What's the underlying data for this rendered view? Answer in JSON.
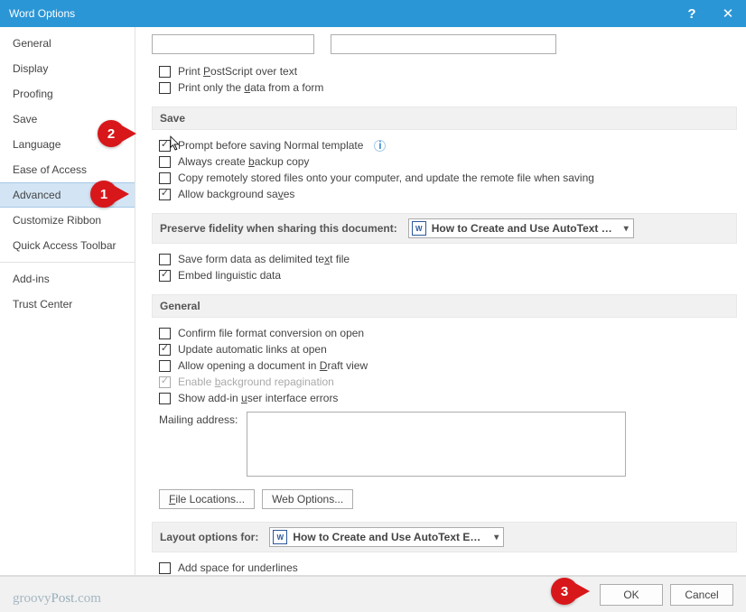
{
  "window": {
    "title": "Word Options",
    "help_symbol": "?",
    "close_symbol": "✕"
  },
  "sidebar": {
    "items": [
      {
        "label": "General"
      },
      {
        "label": "Display"
      },
      {
        "label": "Proofing"
      },
      {
        "label": "Save"
      },
      {
        "label": "Language"
      },
      {
        "label": "Ease of Access"
      },
      {
        "label": "Advanced",
        "selected": true
      },
      {
        "label": "Customize Ribbon"
      },
      {
        "label": "Quick Access Toolbar"
      },
      {
        "label": "Add-ins"
      },
      {
        "label": "Trust Center"
      }
    ]
  },
  "top": {
    "postscript": {
      "label_pre": "Print ",
      "u": "P",
      "label_post": "ostScript over text",
      "checked": false
    },
    "printonly": {
      "label_pre": "Print only the ",
      "u": "d",
      "label_post": "ata from a form",
      "checked": false
    }
  },
  "save_section": {
    "header": "Save",
    "prompt_normal": {
      "label": "Prompt before saving Normal template",
      "checked": true
    },
    "backup": {
      "label_pre": "Always create ",
      "u": "b",
      "label_post": "ackup copy",
      "checked": false
    },
    "copy_remote": {
      "label": "Copy remotely stored files onto your computer, and update the remote file when saving",
      "checked": false
    },
    "bg_saves": {
      "label_pre": "Allow background sa",
      "u": "v",
      "label_post": "es",
      "checked": true
    }
  },
  "preserve_section": {
    "header": "Preserve fidelity when sharing this document:",
    "dropdown_value": "How to Create and Use AutoText Entrie...",
    "save_form": {
      "label_pre": "Save form data as delimited te",
      "u": "x",
      "label_post": "t file",
      "checked": false
    },
    "embed_ling": {
      "label": "Embed linguistic data",
      "checked": true
    }
  },
  "general_section": {
    "header": "General",
    "confirm_conv": {
      "label": "Confirm file format conversion on open",
      "checked": false
    },
    "update_links": {
      "label": "Update automatic links at open",
      "checked": true
    },
    "allow_draft": {
      "label_pre": "Allow opening a document in ",
      "u": "D",
      "label_post": "raft view",
      "checked": false
    },
    "bg_repag": {
      "label_pre": "Enable ",
      "u": "b",
      "label_post": "ackground repagination",
      "checked": true,
      "disabled": true
    },
    "addin_err": {
      "label_pre": "Show add-in ",
      "u": "u",
      "label_post": "ser interface errors",
      "checked": false
    },
    "mailing": {
      "label": "Mailing address:",
      "value": ""
    },
    "file_locations": "File Locations...",
    "web_options": "Web Options..."
  },
  "layout_section": {
    "header": "Layout options for:",
    "dropdown_value": "How to Create and Use AutoText Entrie...",
    "add_space": {
      "label": "Add space for underlines",
      "checked": false
    }
  },
  "buttons": {
    "ok": "OK",
    "cancel": "Cancel"
  },
  "watermark": {
    "pre": "groovy",
    "post": "Post",
    "suffix": ".com"
  },
  "annotations": {
    "n1": "1",
    "n2": "2",
    "n3": "3"
  }
}
